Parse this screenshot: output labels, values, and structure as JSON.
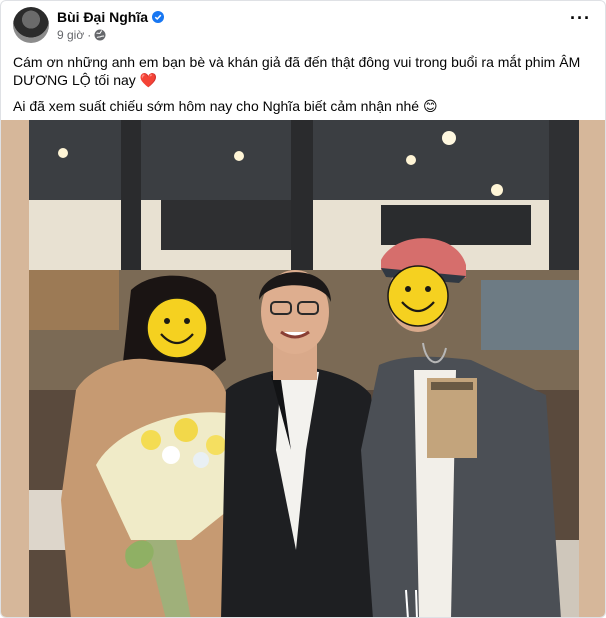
{
  "post": {
    "author": "Bùi Đại Nghĩa",
    "time": "9 giờ",
    "separator": "·",
    "more_label": "···",
    "caption_line1": "Cám ơn những anh em bạn bè và khán giả đã đến thật đông vui trong buổi ra mắt phim ÂM DƯƠNG LỘ tối nay",
    "caption_emoji1": "❤️",
    "caption_line2": "Ai đã xem suất chiếu sớm hôm nay cho Nghĩa biết cảm nhận nhé",
    "caption_emoji2": "😊"
  },
  "icons": {
    "verified": "verified-badge-icon",
    "audience": "globe-icon",
    "more": "more-options-icon"
  },
  "colors": {
    "verified_blue": "#1877f2",
    "meta_gray": "#65676b",
    "heart_red": "#e41e3f"
  }
}
